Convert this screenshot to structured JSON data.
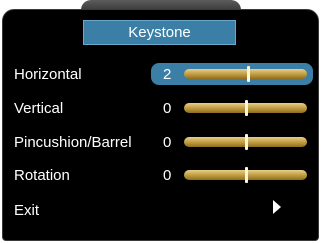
{
  "title": "Keystone",
  "items": [
    {
      "label": "Horizontal",
      "value": "2",
      "slider_fraction": 0.52,
      "selected": true
    },
    {
      "label": "Vertical",
      "value": "0",
      "slider_fraction": 0.5,
      "selected": false
    },
    {
      "label": "Pincushion/Barrel",
      "value": "0",
      "slider_fraction": 0.5,
      "selected": false
    },
    {
      "label": "Rotation",
      "value": "0",
      "slider_fraction": 0.5,
      "selected": false
    }
  ],
  "exit": {
    "label": "Exit",
    "icon": "play-arrow-icon"
  },
  "colors": {
    "highlight": "#3b7fa6",
    "slider": "#bf9a3e",
    "background": "#000000"
  }
}
